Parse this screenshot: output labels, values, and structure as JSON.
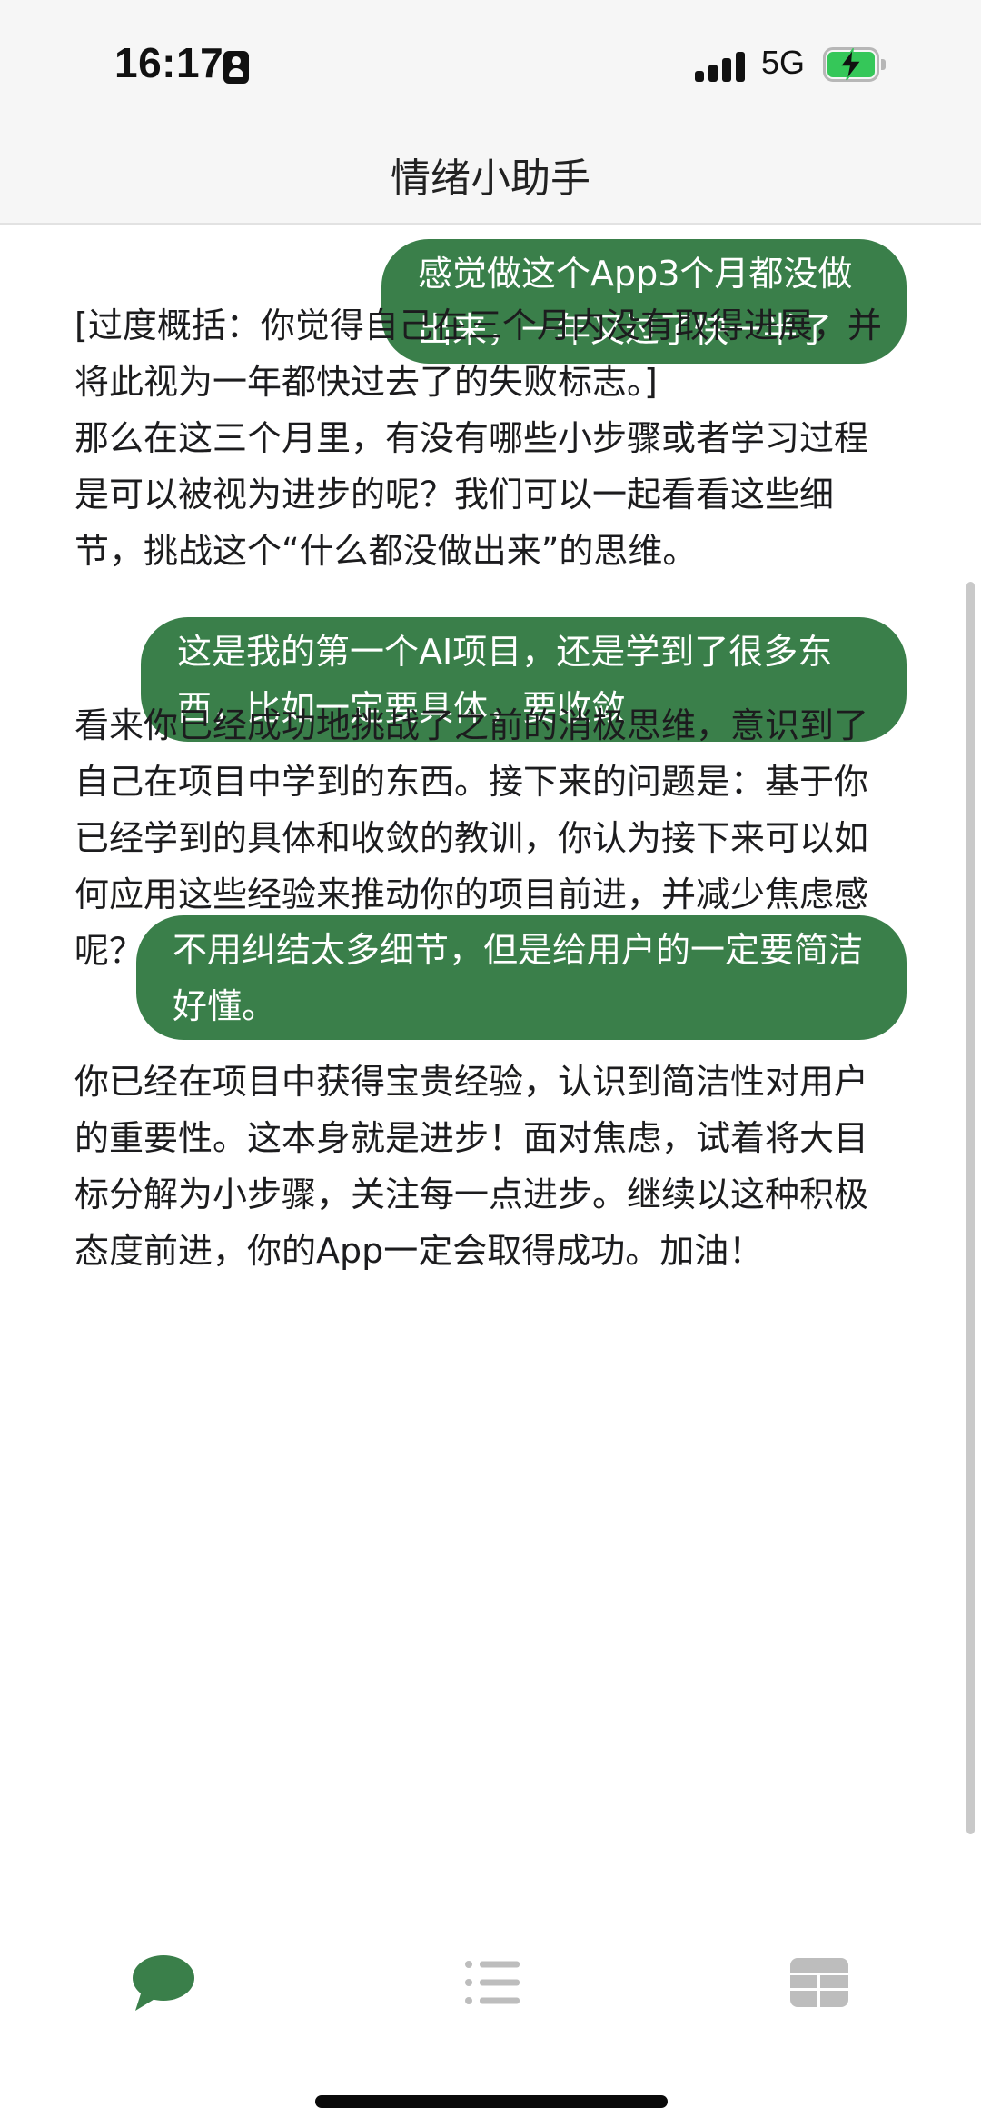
{
  "status_bar": {
    "time": "16:17",
    "network": "5G",
    "icons": [
      "contact-card-icon",
      "signal-bars-icon",
      "battery-charging-icon"
    ],
    "battery_color": "#35c759"
  },
  "header": {
    "title": "情绪小助手"
  },
  "messages": [
    {
      "role": "user",
      "text": "感觉做这个App3个月都没做出来，一年又过了快一半了"
    },
    {
      "role": "assistant",
      "text": "[过度概括：你觉得自己在三个月内没有取得进展，并将此视为一年都快过去了的失败标志。]\n那么在这三个月里，有没有哪些小步骤或者学习过程是可以被视为进步的呢？我们可以一起看看这些细节，挑战这个“什么都没做出来”的思维。"
    },
    {
      "role": "user",
      "text": "这是我的第一个AI项目，还是学到了很多东西，比如一定要具体，要收敛"
    },
    {
      "role": "assistant",
      "text": "看来你已经成功地挑战了之前的消极思维，意识到了自己在项目中学到的东西。接下来的问题是：基于你已经学到的具体和收敛的教训，你认为接下来可以如何应用这些经验来推动你的项目前进，并减少焦虑感呢？"
    },
    {
      "role": "user",
      "text": "不用纠结太多细节，但是给用户的一定要简洁好懂。"
    },
    {
      "role": "assistant",
      "text": "你已经在项目中获得宝贵经验，认识到简洁性对用户的重要性。这本身就是进步！面对焦虑，试着将大目标分解为小步骤，关注每一点进步。继续以这种积极态度前进，你的App一定会取得成功。加油！"
    }
  ],
  "tab_bar": {
    "tabs": [
      {
        "icon": "chat-bubble-icon",
        "active": true
      },
      {
        "icon": "list-icon",
        "active": false
      },
      {
        "icon": "grid-icon",
        "active": false
      }
    ]
  },
  "colors": {
    "user_bubble": "#3a7f4a",
    "active_tab": "#3a7f4a",
    "inactive_tab": "#bdbdbd"
  }
}
